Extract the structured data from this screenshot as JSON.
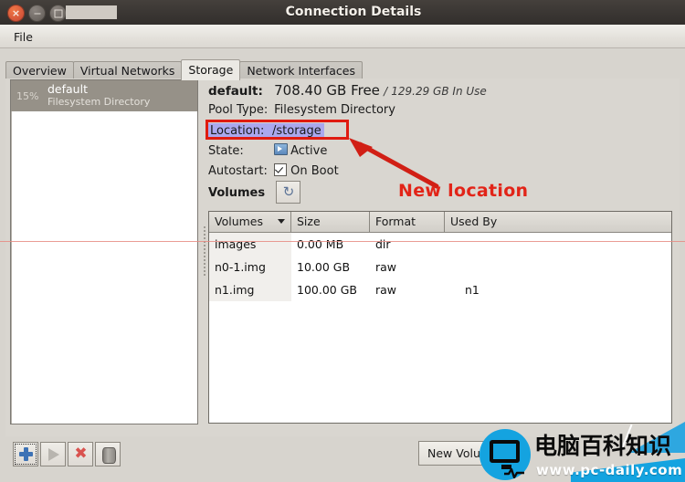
{
  "window": {
    "title": "Connection Details",
    "controls": {
      "close": "×",
      "minimize": "minimize",
      "maximize": "maximize"
    }
  },
  "menubar": {
    "items": [
      {
        "label": "File"
      }
    ]
  },
  "tabs": [
    {
      "label": "Overview",
      "active": false
    },
    {
      "label": "Virtual Networks",
      "active": false
    },
    {
      "label": "Storage",
      "active": true
    },
    {
      "label": "Network Interfaces",
      "active": false
    }
  ],
  "pool_list": [
    {
      "percent": "15%",
      "name": "default",
      "type": "Filesystem Directory"
    }
  ],
  "details": {
    "name_label": "default:",
    "capacity_free": "708.40 GB Free",
    "capacity_sep": "/",
    "capacity_used": "129.29 GB In Use",
    "pool_type_label": "Pool Type:",
    "pool_type_value": "Filesystem Directory",
    "location_label": "Location:",
    "location_value": "/storage",
    "state_label": "State:",
    "state_value": "Active",
    "autostart_label": "Autostart:",
    "autostart_value": "On Boot",
    "volumes_label": "Volumes",
    "refresh_icon": "refresh-icon"
  },
  "volumes_table": {
    "columns": [
      "Volumes",
      "Size",
      "Format",
      "Used By"
    ],
    "sorted_column": "Volumes",
    "rows": [
      {
        "name": "images",
        "size": "0.00 MB",
        "format": "dir",
        "used_by": ""
      },
      {
        "name": "n0-1.img",
        "size": "10.00 GB",
        "format": "raw",
        "used_by": ""
      },
      {
        "name": "n1.img",
        "size": "100.00 GB",
        "format": "raw",
        "used_by": "n1"
      }
    ]
  },
  "toolbar": {
    "add_label": "add-pool",
    "start_label": "start-pool",
    "delete_label": "delete-pool",
    "stop_label": "stop-pool",
    "new_volume_label": "New Volume"
  },
  "annotation": {
    "text": "New location",
    "color": "#e22418",
    "highlight_color": "#aaa8ee"
  },
  "watermark": {
    "brand_cn": "电脑百科知识",
    "url": "www.pc-daily.com",
    "accent": "#14a3e0"
  }
}
